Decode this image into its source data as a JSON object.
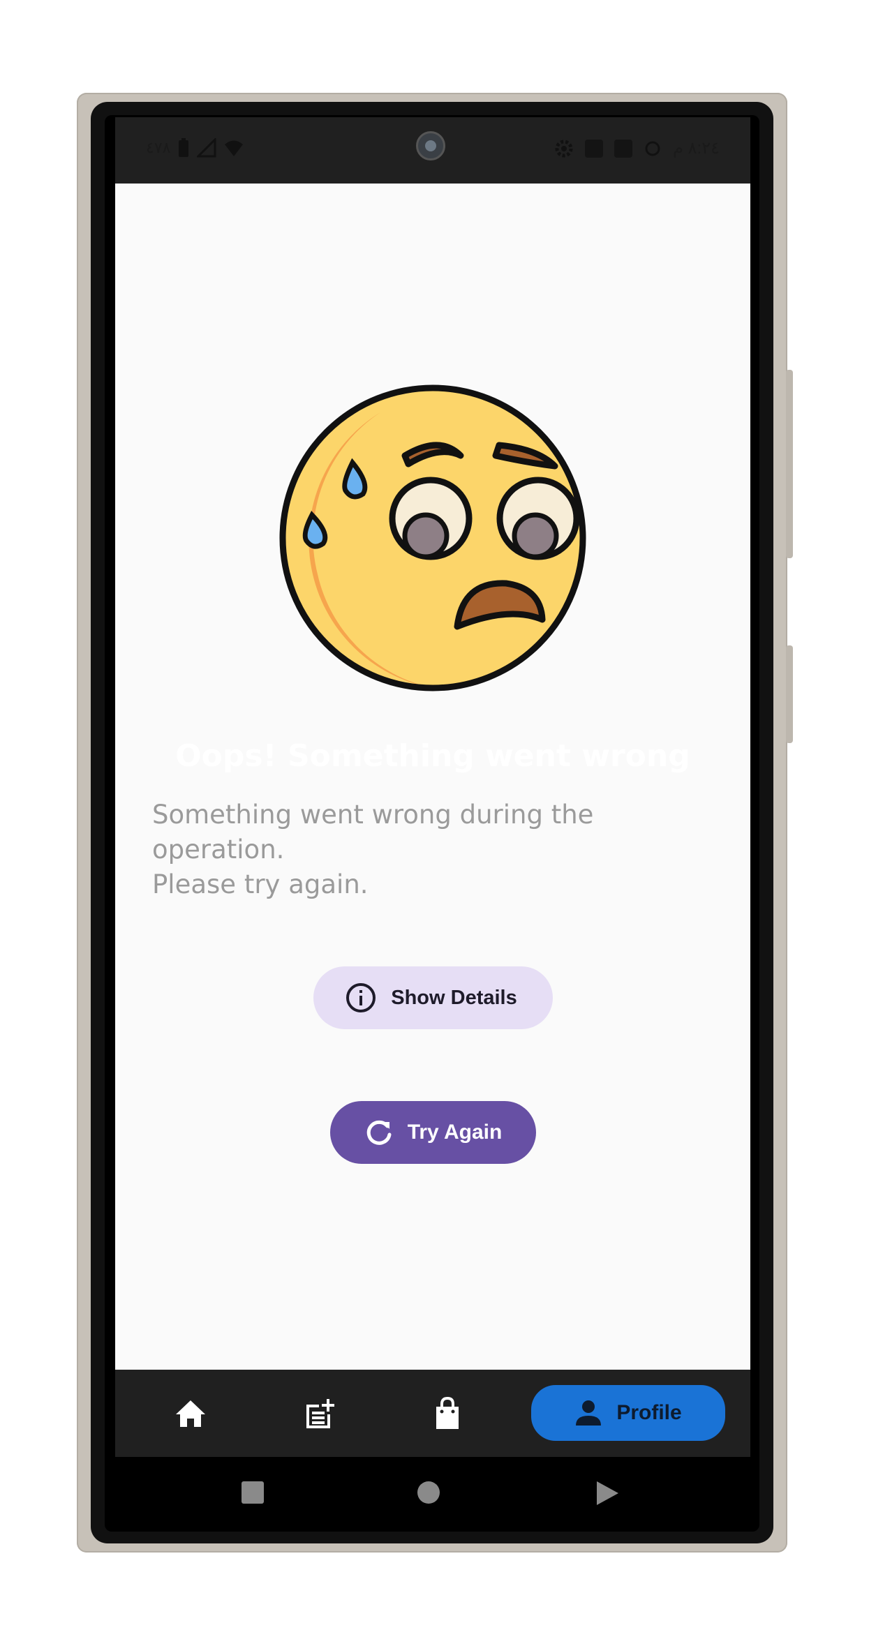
{
  "status_bar": {
    "left_text": "٤٧٨",
    "right_text": "٨:٢٤ م"
  },
  "error": {
    "title": "Oops! Something went wrong",
    "message_lines": [
      "Something went wrong during the",
      "operation.",
      "Please try again."
    ]
  },
  "actions": {
    "show_details_label": "Show Details",
    "try_again_label": "Try Again"
  },
  "bottom_nav": {
    "items": [
      {
        "icon": "home-icon"
      },
      {
        "icon": "post-add-icon"
      },
      {
        "icon": "shopping-bag-icon"
      },
      {
        "icon": "person-icon",
        "label": "Profile",
        "active": true
      }
    ]
  },
  "colors": {
    "primary": "#6750a4",
    "details_bg": "#e6def5",
    "nav_active": "#1a73d6",
    "nav_bg": "#202020",
    "message_text": "#9a9a9a"
  }
}
